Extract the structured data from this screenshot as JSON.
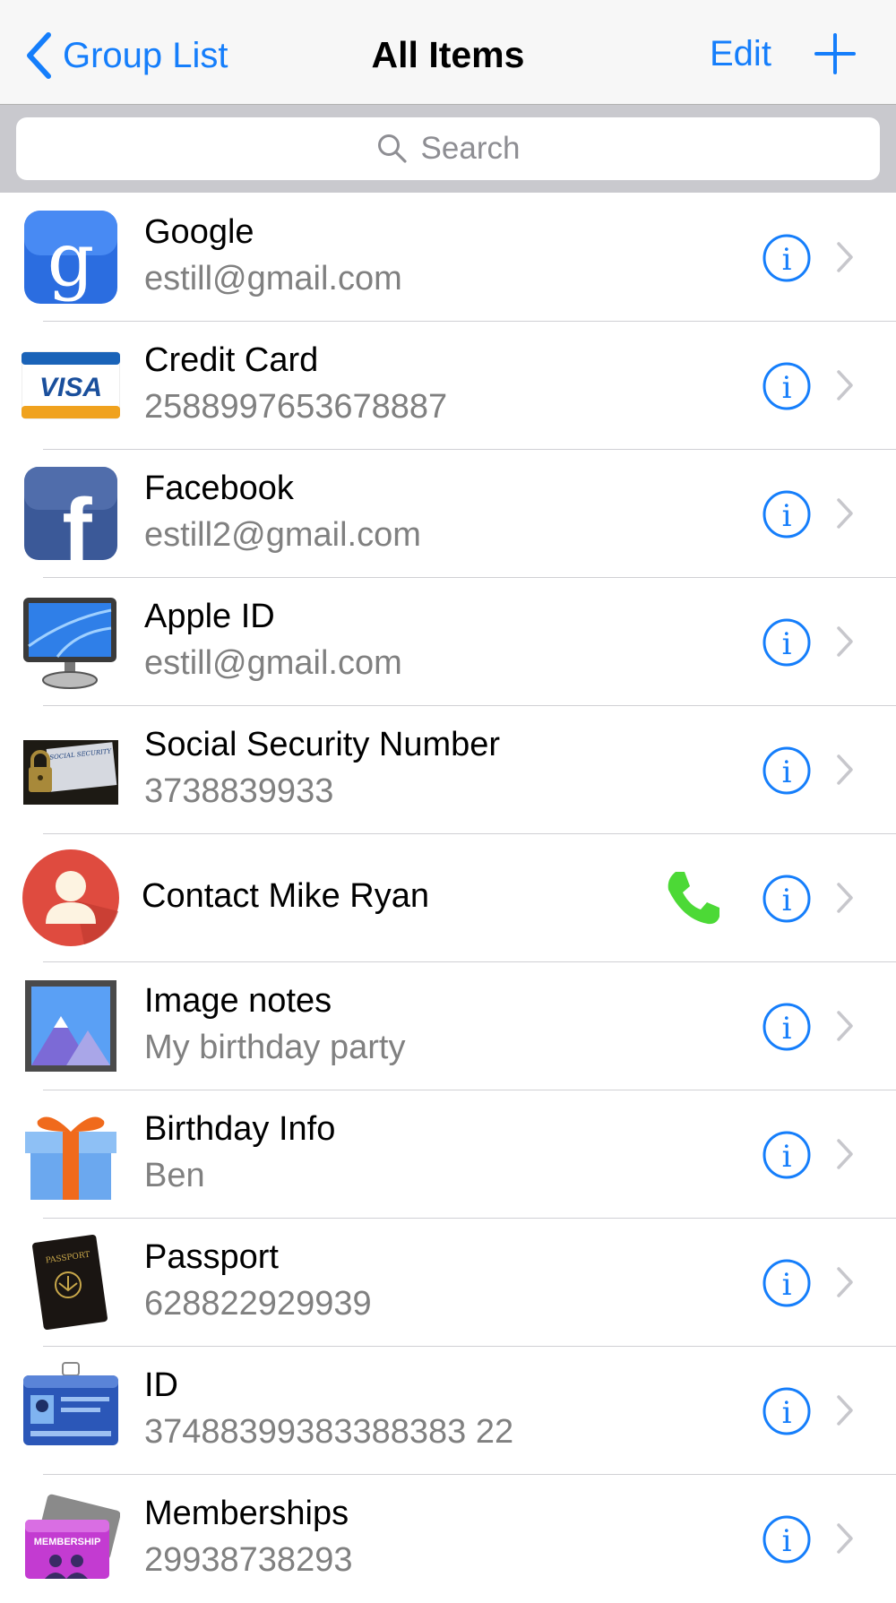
{
  "nav": {
    "back_label": "Group List",
    "title": "All Items",
    "edit_label": "Edit",
    "add_icon": "plus-icon"
  },
  "search": {
    "placeholder": "Search",
    "icon": "search-icon"
  },
  "colors": {
    "accent": "#157efb",
    "phone_green": "#4cd936",
    "subtitle_gray": "#808080"
  },
  "items": [
    {
      "title": "Google",
      "subtitle": "estill@gmail.com",
      "icon": "google-icon"
    },
    {
      "title": "Credit Card",
      "subtitle": "2588997653678887",
      "icon": "visa-card-icon",
      "icon_text": "VISA"
    },
    {
      "title": "Facebook",
      "subtitle": "estill2@gmail.com",
      "icon": "facebook-icon"
    },
    {
      "title": "Apple ID",
      "subtitle": "estill@gmail.com",
      "icon": "computer-monitor-icon"
    },
    {
      "title": "Social Security Number",
      "subtitle": "3738839933",
      "icon": "social-security-card-icon",
      "icon_text": "SOCIAL SECURITY"
    },
    {
      "title": "Contact Mike Ryan",
      "subtitle": "",
      "icon": "contact-person-icon",
      "action": "phone-icon"
    },
    {
      "title": "Image notes",
      "subtitle": "My birthday party",
      "icon": "picture-icon"
    },
    {
      "title": "Birthday Info",
      "subtitle": "Ben",
      "icon": "gift-box-icon"
    },
    {
      "title": "Passport",
      "subtitle": "628822929939",
      "icon": "passport-icon",
      "icon_text": "PASSPORT"
    },
    {
      "title": "ID",
      "subtitle": "37488399383388383 22",
      "icon": "id-badge-icon"
    },
    {
      "title": "Memberships",
      "subtitle": "29938738293",
      "icon": "membership-card-icon",
      "icon_text": "MEMBERSHIP"
    }
  ]
}
